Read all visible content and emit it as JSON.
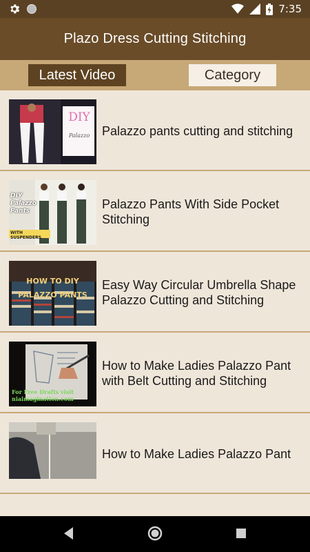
{
  "status_bar": {
    "time": "7:35",
    "left_icons": [
      "gear-icon",
      "circle-icon"
    ],
    "right_icons": [
      "wifi-icon",
      "cell-signal-icon",
      "battery-charging-icon"
    ]
  },
  "app_bar": {
    "title": "Plazo Dress Cutting Stitching"
  },
  "tabs": [
    {
      "label": "Latest Video",
      "selected": true
    },
    {
      "label": "Category",
      "selected": false
    }
  ],
  "videos": [
    {
      "title": "Palazzo pants cutting and stitching",
      "thumb_text": "DIY",
      "thumb_subtext": "Palazzo"
    },
    {
      "title": "Palazzo Pants With Side Pocket Stitching",
      "thumb_text": "DIY Palazzo Pants",
      "thumb_subtext": "WITH SUSPENDERS"
    },
    {
      "title": "Easy Way Circular Umbrella Shape Palazzo Cutting and Stitching",
      "thumb_text": "HOW TO DIY PALAZZO PANTS",
      "thumb_subtext": ""
    },
    {
      "title": "How to Make Ladies Palazzo Pant with Belt Cutting and Stitching",
      "thumb_text": "For Free Drafts visit",
      "thumb_subtext": "niaimagination.com"
    },
    {
      "title": "How to Make Ladies Palazzo Pant",
      "thumb_text": "",
      "thumb_subtext": ""
    }
  ],
  "nav_bar": {
    "buttons": [
      "back-icon",
      "home-icon",
      "recents-icon"
    ]
  },
  "colors": {
    "status_bar": "#5a4123",
    "app_bar": "#6a4c28",
    "tab_bar": "#c7a877",
    "tab_selected": "#5e4322",
    "background": "#efe6da",
    "divider": "#c7a877"
  }
}
